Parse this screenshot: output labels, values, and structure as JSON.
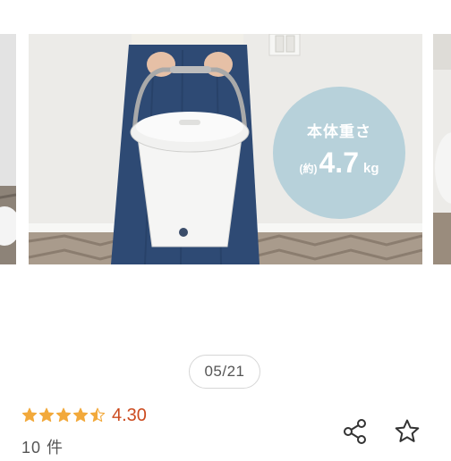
{
  "carousel": {
    "badge": {
      "line1": "本体重さ",
      "prefix": "(約)",
      "value": "4.7",
      "unit": "kg"
    },
    "indicator": "05/21"
  },
  "rating": {
    "stars": 4.5,
    "value": "4.30",
    "count": "10 件",
    "star_color": "#f2a93b",
    "value_color": "#cc4b1f"
  },
  "actions": {
    "share_icon": "share-icon",
    "favorite_icon": "star-outline-icon"
  }
}
